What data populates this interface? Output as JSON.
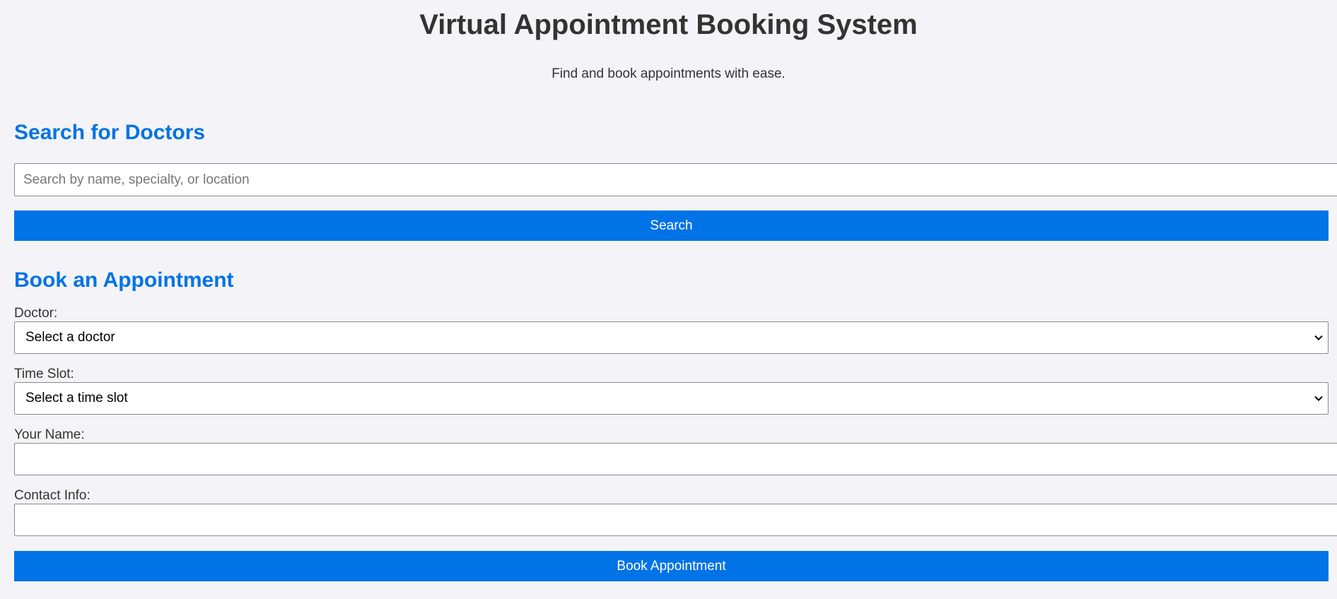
{
  "header": {
    "title": "Virtual Appointment Booking System",
    "tagline": "Find and book appointments with ease."
  },
  "search": {
    "heading": "Search for Doctors",
    "placeholder": "Search by name, specialty, or location",
    "value": "",
    "button_label": "Search"
  },
  "booking": {
    "heading": "Book an Appointment",
    "doctor_label": "Doctor:",
    "doctor_selected": "Select a doctor",
    "time_label": "Time Slot:",
    "time_selected": "Select a time slot",
    "name_label": "Your Name:",
    "name_value": "",
    "contact_label": "Contact Info:",
    "contact_value": "",
    "button_label": "Book Appointment"
  },
  "colors": {
    "accent": "#0073e6",
    "background": "#f4f4f8",
    "text": "#333333"
  },
  "icons": {
    "dropdown": "chevron-down-icon"
  }
}
